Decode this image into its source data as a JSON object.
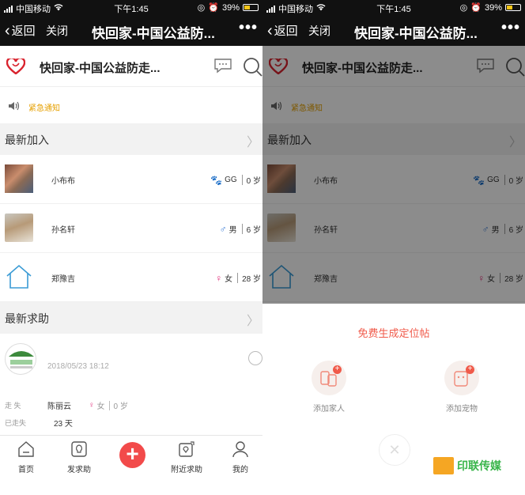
{
  "status_bar": {
    "carrier": "中国移动",
    "time": "下午1:45",
    "battery": "39%"
  },
  "nav": {
    "back_label": "返回",
    "close_label": "关闭",
    "title": "快回家-中国公益防...",
    "more_label": "•••"
  },
  "app_header": {
    "title": "快回家-中国公益防走..."
  },
  "notice": {
    "text": "紧急通知"
  },
  "latest_joined": {
    "title": "最新加入",
    "items": [
      {
        "name": "小布布",
        "gender": "GG",
        "age": "0 岁",
        "icon": "paw-icon",
        "color": "#3a7bd5"
      },
      {
        "name": "孙名轩",
        "gender": "男",
        "age": "6 岁",
        "icon": "male-icon",
        "color": "#3a7bd5"
      },
      {
        "name": "郑豫吉",
        "gender": "女",
        "age": "28 岁",
        "icon": "female-icon",
        "color": "#e0307a"
      }
    ]
  },
  "latest_help": {
    "title": "最新求助",
    "date": "2018/05/23 18:12",
    "label_lost": "走 失",
    "name": "陈丽云",
    "gender": "女",
    "age": "0 岁",
    "label_lost_for": "已走失",
    "days": "23 天"
  },
  "tabbar": {
    "home": "首页",
    "post": "发求助",
    "nearby": "附近求助",
    "mine": "我的"
  },
  "sheet": {
    "title": "免费生成定位帖",
    "add_family": "添加家人",
    "add_pet": "添加宠物",
    "close": "✕"
  },
  "watermark": {
    "text": "印联传媒"
  },
  "colors": {
    "accent": "#f05a4a",
    "notice": "#e6a000",
    "nav_bg": "#111111"
  }
}
